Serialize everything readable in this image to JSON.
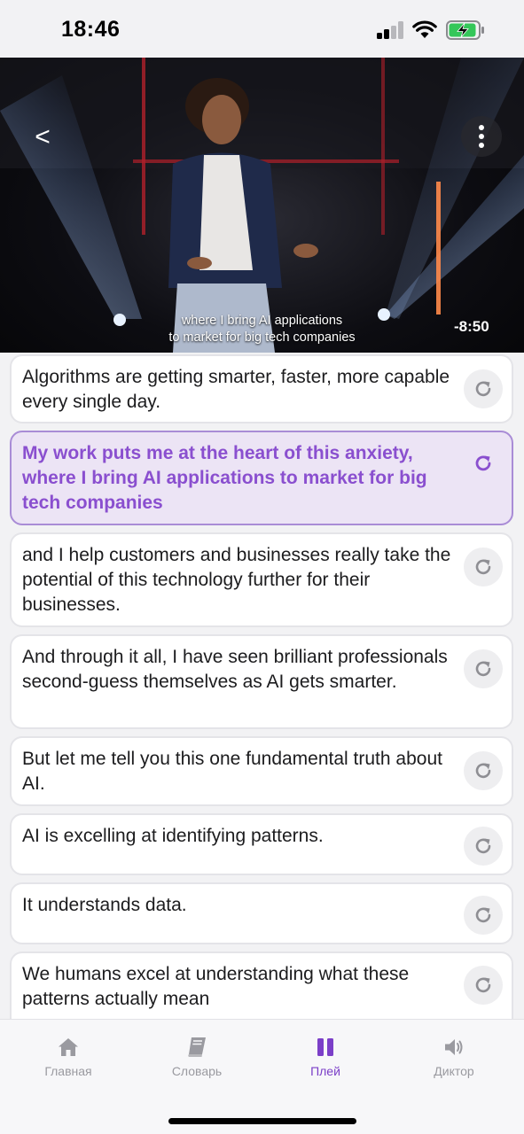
{
  "status_bar": {
    "time": "18:46",
    "signal_icon": "cellular-signal-icon",
    "wifi_icon": "wifi-icon",
    "battery_icon": "battery-charging-icon",
    "battery_color": "#34c759"
  },
  "video": {
    "back_label": "<",
    "more_icon": "more-vertical-icon",
    "subtitle_line1": "where I bring AI applications",
    "subtitle_line2": "to market for big tech companies",
    "time_remaining": "-8:50"
  },
  "transcript": [
    {
      "text": "Algorithms are getting smarter, faster, more capable every single day.",
      "active": false
    },
    {
      "text": "My work puts me at the heart of this anxiety, where I bring AI applications to market for big tech companies",
      "active": true
    },
    {
      "text": "and I help customers and businesses really take the potential of this technology further for their businesses.",
      "active": false
    },
    {
      "text": "And through it all, I have seen brilliant professionals second-guess themselves as AI gets smarter.",
      "active": false
    },
    {
      "text": "But let me tell you this one fundamental truth about AI.",
      "active": false
    },
    {
      "text": "AI is excelling at identifying patterns.",
      "active": false
    },
    {
      "text": "It understands data.",
      "active": false
    },
    {
      "text": "We humans excel at understanding what these patterns actually mean",
      "active": false
    }
  ],
  "tabs": [
    {
      "label": "Главная",
      "icon": "home-icon",
      "active": false
    },
    {
      "label": "Словарь",
      "icon": "book-icon",
      "active": false
    },
    {
      "label": "Плей",
      "icon": "pause-icon",
      "active": true
    },
    {
      "label": "Диктор",
      "icon": "speaker-icon",
      "active": false
    }
  ],
  "colors": {
    "accent": "#7b3fc8",
    "active_text": "#8a4fcf",
    "active_card_bg": "#ece4f5",
    "active_card_border": "#a98cd6",
    "inactive_icon": "#9a9aa0"
  }
}
